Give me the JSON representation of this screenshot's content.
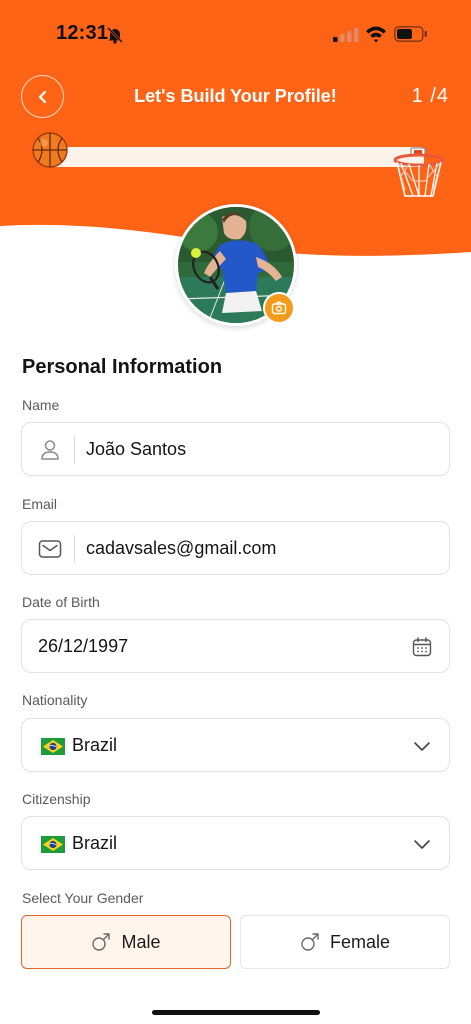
{
  "status_bar": {
    "time": "12:31"
  },
  "header": {
    "title": "Let's Build Your Profile!",
    "step": "1 /4"
  },
  "progress": {
    "fraction": 0.02
  },
  "section_title": "Personal Information",
  "fields": {
    "name": {
      "label": "Name",
      "value": "João Santos"
    },
    "email": {
      "label": "Email",
      "value": "cadavsales@gmail.com"
    },
    "dob": {
      "label": "Date of Birth",
      "value": "26/12/1997"
    },
    "nationality": {
      "label": "Nationality",
      "value": "Brazil"
    },
    "citizenship": {
      "label": "Citizenship",
      "value": "Brazil"
    }
  },
  "gender": {
    "label": "Select Your Gender",
    "options": [
      "Male",
      "Female"
    ],
    "selected": "Male"
  },
  "colors": {
    "primary": "#ff6316",
    "accent": "#f49b1c",
    "selected_bg": "#fff5ec",
    "selected_border": "#e0662d"
  },
  "icons": [
    "back-arrow-icon",
    "bell-off-icon",
    "signal-icon",
    "wifi-icon",
    "battery-icon",
    "basketball-icon",
    "hoop-icon",
    "camera-icon",
    "user-icon",
    "mail-icon",
    "calendar-icon",
    "chevron-down-icon",
    "brazil-flag-icon",
    "male-symbol-icon"
  ]
}
